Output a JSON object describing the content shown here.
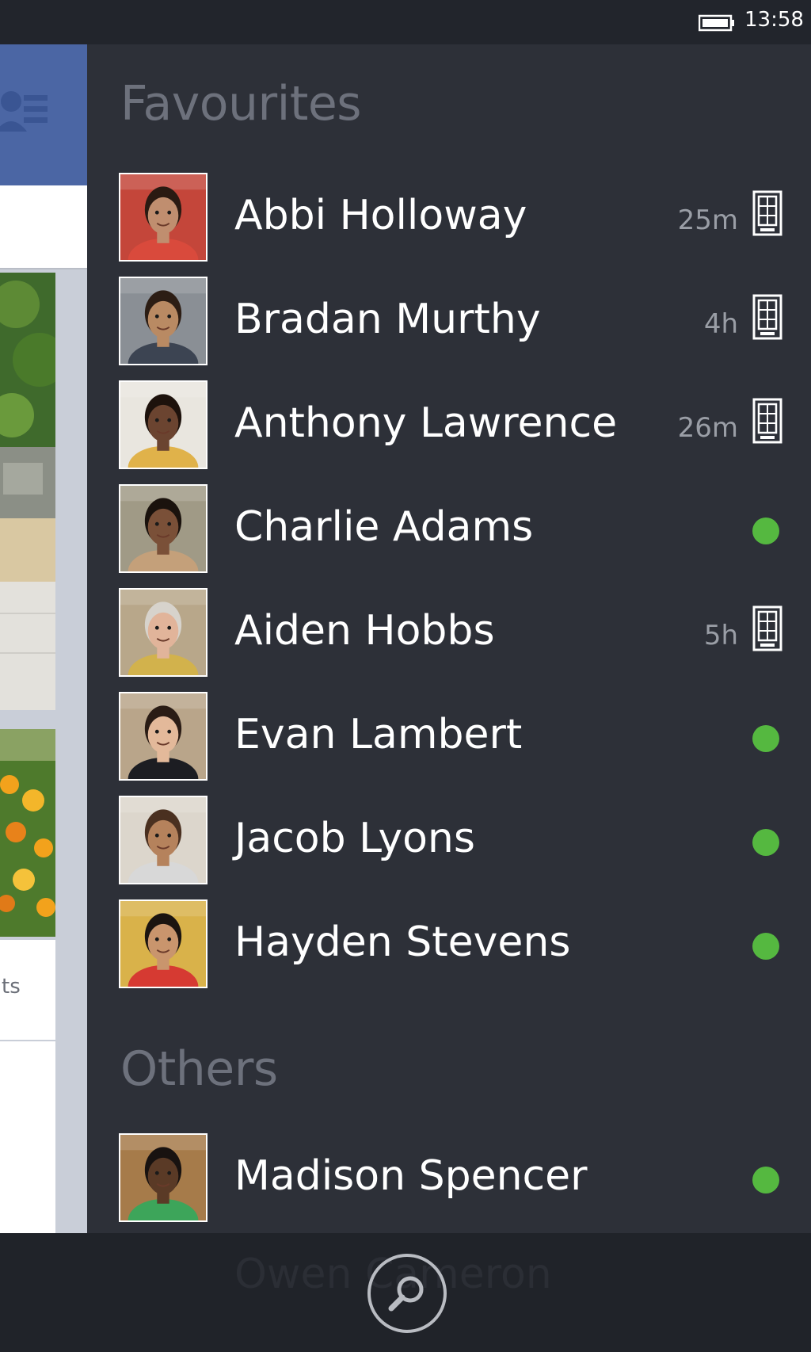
{
  "status_bar": {
    "time": "13:58"
  },
  "feed": {
    "partial_text": "ts"
  },
  "favourites": {
    "title": "Favourites",
    "contacts": [
      {
        "name": "Abbi Holloway",
        "time": "25m",
        "status": "mobile"
      },
      {
        "name": "Bradan Murthy",
        "time": "4h",
        "status": "mobile"
      },
      {
        "name": "Anthony Lawrence",
        "time": "26m",
        "status": "mobile"
      },
      {
        "name": "Charlie Adams",
        "status": "online"
      },
      {
        "name": "Aiden Hobbs",
        "time": "5h",
        "status": "mobile"
      },
      {
        "name": "Evan Lambert",
        "status": "online"
      },
      {
        "name": "Jacob Lyons",
        "status": "online"
      },
      {
        "name": "Hayden Stevens",
        "status": "online"
      }
    ]
  },
  "others": {
    "title": "Others",
    "contacts": [
      {
        "name": "Madison Spencer",
        "status": "online"
      }
    ]
  },
  "app_bar": {
    "ghost_text": "Owen Cameron",
    "search_icon": "search-icon"
  },
  "colors": {
    "online": "#55b840",
    "panel": "#2d3038",
    "brand": "#4b66a4"
  }
}
